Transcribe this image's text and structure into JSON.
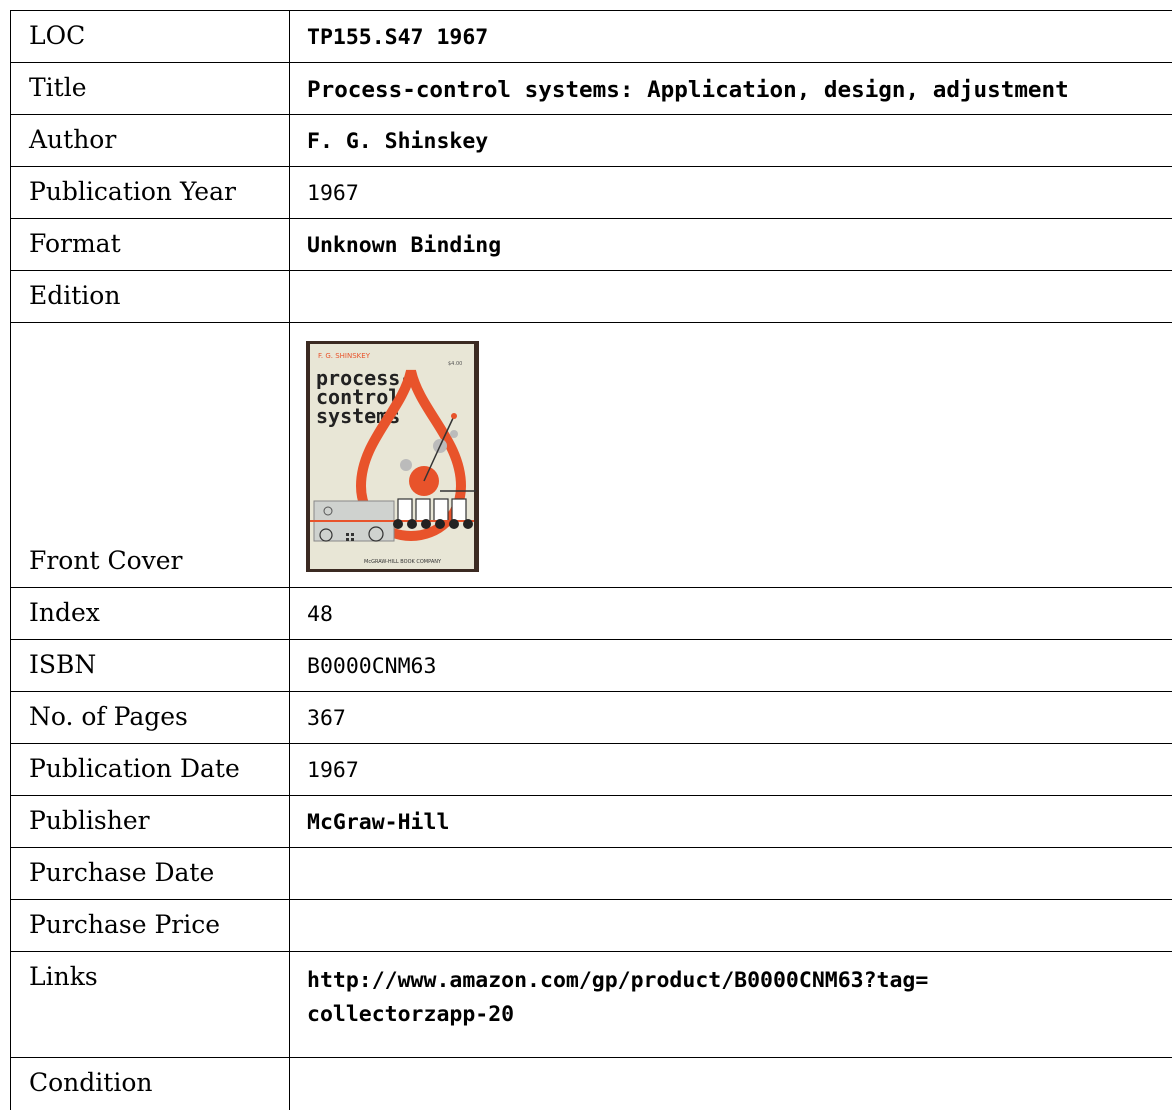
{
  "record": {
    "loc": {
      "label": "LOC",
      "value": "TP155.S47 1967"
    },
    "title": {
      "label": "Title",
      "value": "Process-control systems: Application, design, adjustment"
    },
    "author": {
      "label": "Author",
      "value": "F. G. Shinskey"
    },
    "publication_year": {
      "label": "Publication Year",
      "value": "1967"
    },
    "format": {
      "label": "Format",
      "value": "Unknown Binding"
    },
    "edition": {
      "label": "Edition",
      "value": ""
    },
    "front_cover": {
      "label": "Front Cover",
      "image": {
        "author": "F. G. SHINSKEY",
        "price": "$4.00",
        "title_lines": [
          "process-",
          "control",
          "systems"
        ],
        "publisher": "McGRAW-HILL BOOK COMPANY",
        "colors": {
          "background": "#e8e6d6",
          "accent": "#e8532b",
          "frame": "#3b2a22"
        }
      }
    },
    "index": {
      "label": "Index",
      "value": "48"
    },
    "isbn": {
      "label": "ISBN",
      "value": "B0000CNM63"
    },
    "pages": {
      "label": "No. of Pages",
      "value": "367"
    },
    "publication_date": {
      "label": "Publication Date",
      "value": "1967"
    },
    "publisher": {
      "label": "Publisher",
      "value": "McGraw-Hill"
    },
    "purchase_date": {
      "label": "Purchase Date",
      "value": ""
    },
    "purchase_price": {
      "label": "Purchase Price",
      "value": ""
    },
    "links": {
      "label": "Links",
      "value": "http://www.amazon.com/gp/product/B0000CNM63?tag=\ncollectorzapp-20"
    },
    "condition": {
      "label": "Condition",
      "value": ""
    }
  }
}
